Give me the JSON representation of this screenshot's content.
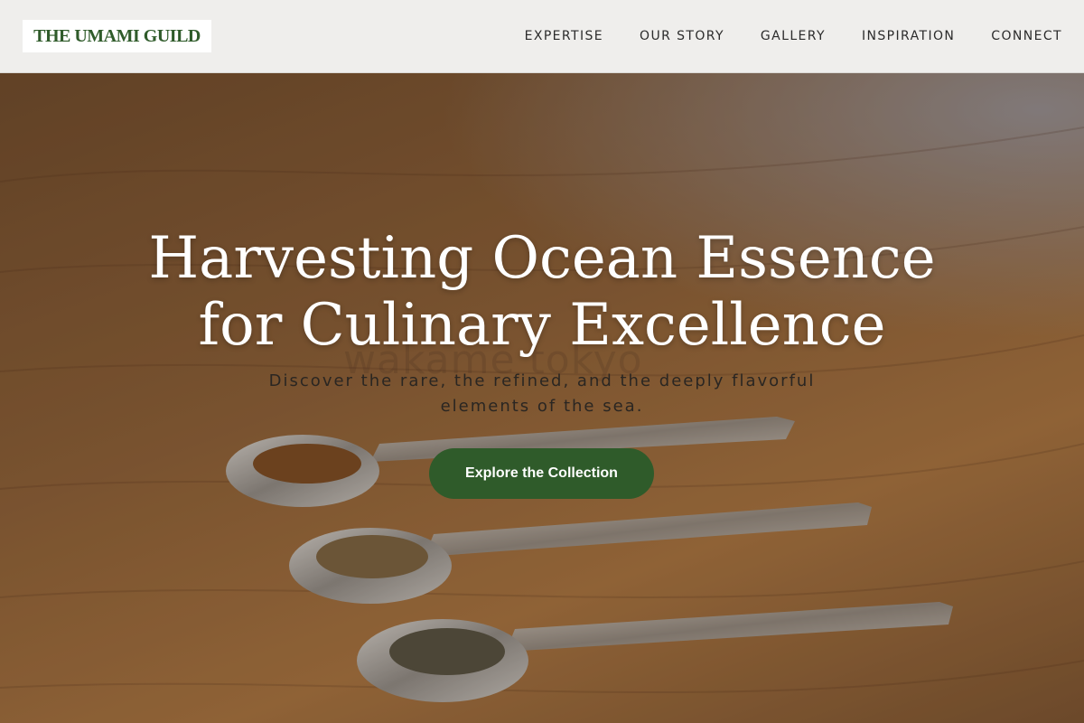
{
  "header": {
    "logo": "THE UMAMI GUILD",
    "nav": [
      "EXPERTISE",
      "OUR STORY",
      "GALLERY",
      "INSPIRATION",
      "CONNECT"
    ]
  },
  "hero": {
    "title_line1": "Harvesting Ocean Essence",
    "title_line2": "for Culinary Excellence",
    "subtitle_line1": "Discover the rare, the refined, and the deeply flavorful",
    "subtitle_line2": "elements of the sea.",
    "cta": "Explore the Collection",
    "watermark": "wakame tokyo"
  },
  "colors": {
    "brand_green": "#2f5b2a",
    "header_bg": "#efeeec",
    "wood": "#a6723f"
  }
}
